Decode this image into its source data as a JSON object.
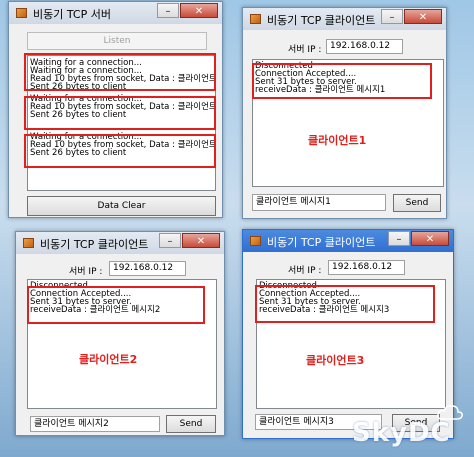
{
  "server": {
    "title": "비동기 TCP 서버",
    "listen_label": "Listen",
    "log": [
      "Waiting for a connection...",
      "Waiting for a connection...",
      "Read 10 bytes from socket, Data : 클라이언트",
      "Sent 26 bytes to client",
      "Waiting for a connection...",
      "Read 10 bytes from socket, Data : 클라이언트",
      "Sent 26 bytes to client",
      "Waiting for a connection...",
      "Read 10 bytes from socket, Data : 클라이언트",
      "Sent 26 bytes to client"
    ],
    "clear_label": "Data Clear"
  },
  "client1": {
    "title": "비동기 TCP 클라이언트",
    "ip_label": "서버 IP :",
    "ip_value": "192.168.0.12",
    "log": [
      "Disconnected",
      "Connection Accepted....",
      "Sent 31 bytes to server.",
      "receiveData : 클라이언트 메시지1"
    ],
    "caption": "클라이언트1",
    "message": "클라이언트 메시지1",
    "send_label": "Send"
  },
  "client2": {
    "title": "비동기 TCP 클라이언트",
    "ip_label": "서버 IP :",
    "ip_value": "192.168.0.12",
    "log": [
      "Disconnected",
      "Connection Accepted....",
      "Sent 31 bytes to server.",
      "receiveData : 클라이언트 메시지2"
    ],
    "caption": "클라이언트2",
    "message": "클라이언트 메시지2",
    "send_label": "Send"
  },
  "client3": {
    "title": "비동기 TCP 클라이언트",
    "ip_label": "서버 IP :",
    "ip_value": "192.168.0.12",
    "log": [
      "Disconnected",
      "Connection Accepted....",
      "Sent 31 bytes to server.",
      "receiveData : 클라이언트 메시지3"
    ],
    "caption": "클라이언트3",
    "message": "클라이언트 메시지3",
    "send_label": "Send"
  },
  "window_buttons": {
    "minimize": "–",
    "maximize": "□",
    "close": "✕"
  },
  "watermark": "SkyDC",
  "colors": {
    "highlight": "#e0201c",
    "active_title": "#2f6fd1"
  }
}
